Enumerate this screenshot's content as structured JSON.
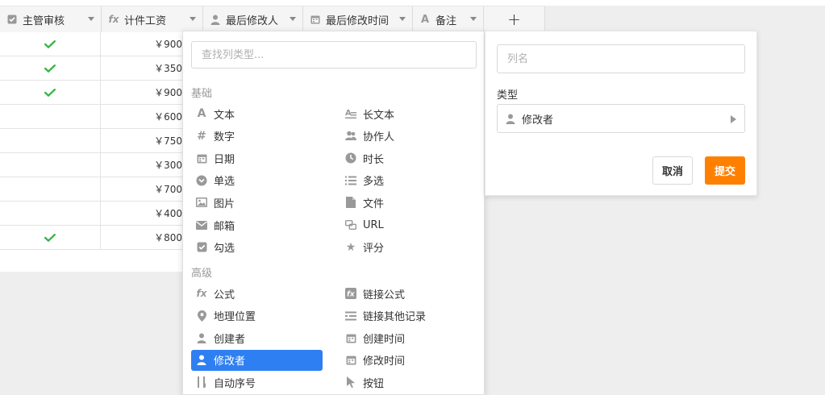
{
  "table": {
    "columns": [
      {
        "label": "主管审核",
        "icon": "checkbox-icon"
      },
      {
        "label": "计件工资",
        "icon": "formula-icon"
      },
      {
        "label": "最后修改人",
        "icon": "user-icon"
      },
      {
        "label": "最后修改时间",
        "icon": "calendar-icon"
      },
      {
        "label": "备注",
        "icon": "text-icon"
      }
    ],
    "add_column": "+",
    "rows": [
      {
        "checked": true,
        "wage": "￥900"
      },
      {
        "checked": true,
        "wage": "￥350"
      },
      {
        "checked": true,
        "wage": "￥900"
      },
      {
        "checked": false,
        "wage": "￥600"
      },
      {
        "checked": false,
        "wage": "￥750"
      },
      {
        "checked": false,
        "wage": "￥300"
      },
      {
        "checked": false,
        "wage": "￥700"
      },
      {
        "checked": false,
        "wage": "￥400"
      },
      {
        "checked": true,
        "wage": "￥800"
      }
    ]
  },
  "type_menu": {
    "search_placeholder": "查找列类型...",
    "basic_title": "基础",
    "basic_items": [
      {
        "label": "文本",
        "icon": "text-icon"
      },
      {
        "label": "长文本",
        "icon": "long-text-icon"
      },
      {
        "label": "数字",
        "icon": "number-icon"
      },
      {
        "label": "协作人",
        "icon": "collaborator-icon"
      },
      {
        "label": "日期",
        "icon": "calendar-icon"
      },
      {
        "label": "时长",
        "icon": "clock-icon"
      },
      {
        "label": "单选",
        "icon": "single-select-icon"
      },
      {
        "label": "多选",
        "icon": "multi-select-icon"
      },
      {
        "label": "图片",
        "icon": "image-icon"
      },
      {
        "label": "文件",
        "icon": "file-icon"
      },
      {
        "label": "邮箱",
        "icon": "email-icon"
      },
      {
        "label": "URL",
        "icon": "link-icon"
      },
      {
        "label": "勾选",
        "icon": "checkbox-icon"
      },
      {
        "label": "评分",
        "icon": "star-icon"
      }
    ],
    "advanced_title": "高级",
    "advanced_items": [
      {
        "label": "公式",
        "icon": "formula-icon"
      },
      {
        "label": "链接公式",
        "icon": "link-formula-icon"
      },
      {
        "label": "地理位置",
        "icon": "location-icon"
      },
      {
        "label": "链接其他记录",
        "icon": "link-record-icon"
      },
      {
        "label": "创建者",
        "icon": "user-icon"
      },
      {
        "label": "创建时间",
        "icon": "calendar-icon"
      },
      {
        "label": "修改者",
        "icon": "user-icon",
        "active": true
      },
      {
        "label": "修改时间",
        "icon": "calendar-icon"
      },
      {
        "label": "自动序号",
        "icon": "auto-number-icon"
      },
      {
        "label": "按钮",
        "icon": "cursor-icon"
      }
    ]
  },
  "form": {
    "name_placeholder": "列名",
    "type_label": "类型",
    "type_value": "修改者",
    "cancel_label": "取消",
    "submit_label": "提交"
  },
  "colors": {
    "accent_blue": "#2e7ff1",
    "submit_orange": "#ff8000",
    "check_green": "#3cb54a",
    "icon_gray": "#999999"
  }
}
